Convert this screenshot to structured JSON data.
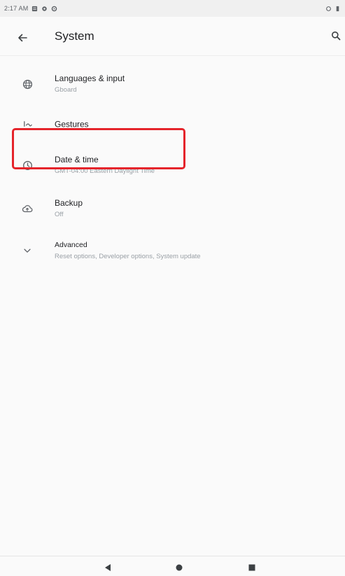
{
  "status_bar": {
    "time": "2:17 AM",
    "left_icons": [
      "notification-icon",
      "settings-icon",
      "sync-icon"
    ],
    "right_icons": [
      "wifi-icon",
      "battery-icon"
    ]
  },
  "app_bar": {
    "title": "System",
    "back_icon": "arrow-back-icon",
    "search_icon": "search-icon"
  },
  "items": [
    {
      "title": "Languages & input",
      "summary": "Gboard",
      "icon": "globe-icon"
    },
    {
      "title": "Gestures",
      "summary": "",
      "icon": "gestures-icon"
    },
    {
      "title": "Date & time",
      "summary": "GMT-04:00 Eastern Daylight Time",
      "icon": "clock-icon"
    },
    {
      "title": "Backup",
      "summary": "Off",
      "icon": "cloud-upload-icon"
    },
    {
      "title": "Advanced",
      "summary": "Reset options, Developer options, System update",
      "icon": "chevron-down-icon"
    }
  ],
  "highlight_color": "#e5242b",
  "nav_bar": {
    "icons": [
      "nav-back-icon",
      "nav-home-icon",
      "nav-recents-icon"
    ]
  }
}
